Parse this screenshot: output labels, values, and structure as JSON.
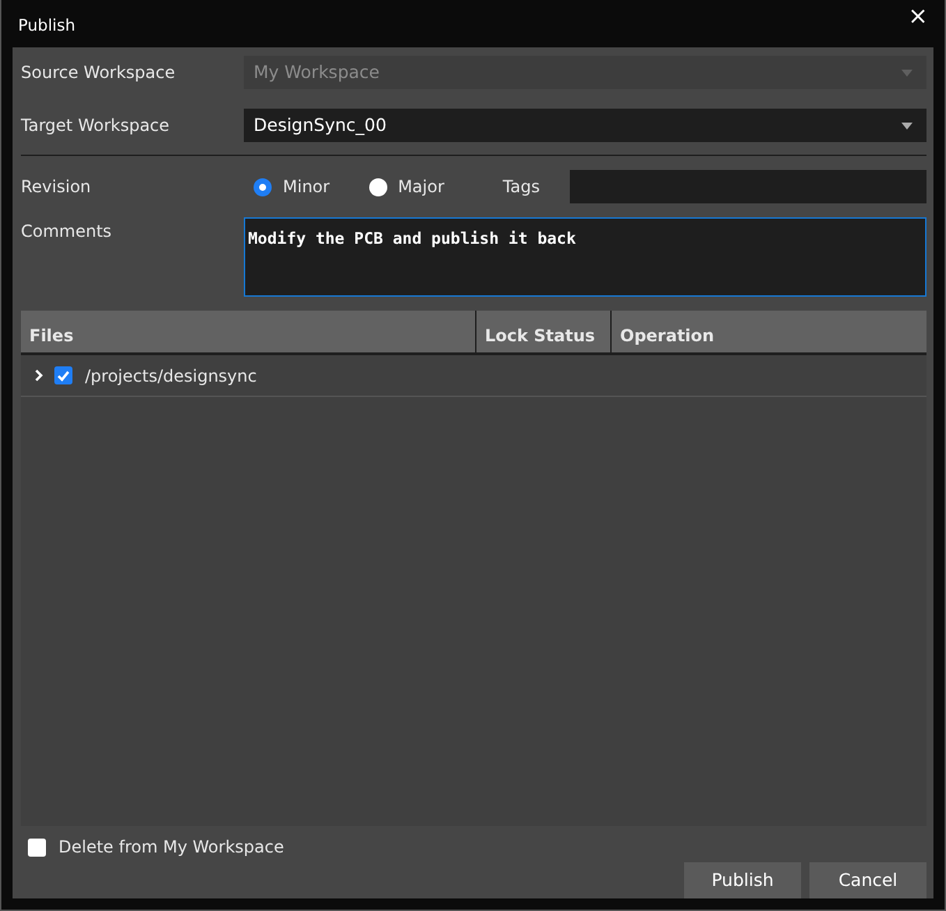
{
  "window": {
    "title": "Publish",
    "close": "×"
  },
  "source_workspace": {
    "label": "Source Workspace",
    "value": "My Workspace",
    "disabled": true
  },
  "target_workspace": {
    "label": "Target Workspace",
    "value": "DesignSync_00",
    "disabled": false
  },
  "revision": {
    "label": "Revision",
    "options": [
      {
        "label": "Minor",
        "selected": true
      },
      {
        "label": "Major",
        "selected": false
      }
    ]
  },
  "tags": {
    "label": "Tags"
  },
  "comments": {
    "label": "Comments",
    "value": "Modify the PCB and publish it back"
  },
  "table": {
    "columns": [
      "Files",
      "Lock Status",
      "Operation"
    ],
    "rows": [
      {
        "file": "/projects/designsync",
        "checked": true,
        "expanded": false
      }
    ]
  },
  "delete_option": {
    "label": "Delete from My Workspace",
    "checked": false
  },
  "buttons": [
    "Publish",
    "Cancel"
  ]
}
